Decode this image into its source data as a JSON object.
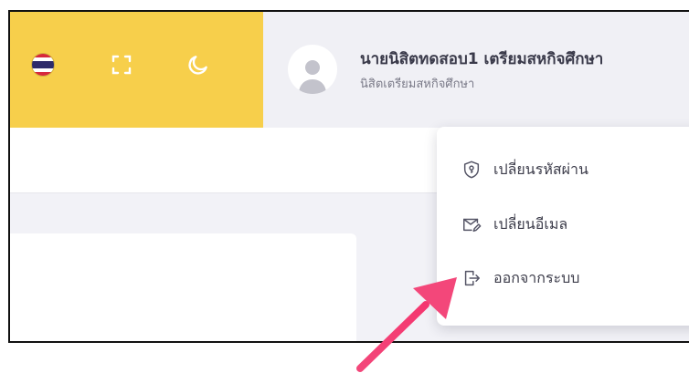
{
  "header": {
    "language_flag": {
      "icon": "thai-flag-icon",
      "colors": [
        "#d6283c",
        "#ffffff",
        "#2d2a6a",
        "#ffffff",
        "#d6283c"
      ]
    },
    "fullscreen_icon": "fullscreen-icon",
    "theme_icon": "moon-icon",
    "accent_color": "#f7cf4b"
  },
  "user": {
    "name": "นายนิสิตทดสอบ1 เตรียมสหกิจศึกษา",
    "role": "นิสิตเตรียมสหกิจศึกษา",
    "avatar_icon": "user-avatar-icon"
  },
  "user_menu": {
    "items": [
      {
        "label": "เปลี่ยนรหัสผ่าน",
        "icon": "key-shield-icon"
      },
      {
        "label": "เปลี่ยนอีเมล",
        "icon": "mail-edit-icon"
      },
      {
        "label": "ออกจากระบบ",
        "icon": "logout-icon"
      }
    ]
  },
  "annotation": {
    "arrow_color": "#f3477a"
  }
}
